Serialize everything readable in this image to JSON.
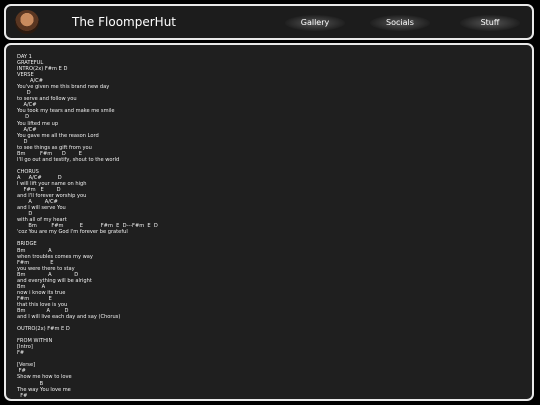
{
  "header": {
    "site_title": "The FloomperHut",
    "nav": [
      "Gallery",
      "Socials",
      "Stuff"
    ]
  },
  "content": {
    "lyrics": "DAY 1\nGRATEFUL\nINTRO(2x) F#m E D\nVERSE\n        A/C#\nYou've given me this brand new day\n      D\nto serve and follow you\n    A/C#\nYou took my tears and make me smile\n     D\nYou lifted me up\n    A/C#\nYou gave me all the reason Lord\n    D\nto see things as gift from you\nBm         F#m      D        E\nI'll go out and testify, shout to the world\n\nCHORUS\nA     A/C#          D\nI will lift your name on high\n    F#m   E        D\nand I'll forever worship you\n       A        A/C#\nand I will serve You\n       D\nwith all of my heart\n       Bm         F#m          E           F#m  E  D---F#m  E  D\n'coz You are my God I'm forever be grateful\n\nBRIDGE\nBm              A\nwhen troubles comes my way\nF#m             E\nyou were there to stay\nBm              A              D\nand everything will be alright\nBm          A\nnow i know its true\nF#m            E\nthat this love is you\nBm             A         D\nand I will live each day and say (Chorus)\n\nOUTRO(2x) F#m E D\n\nFROM WITHIN\n[Intro]\nF#\n\n[Verse]\n F#\nShow me how to love\n              B\nThe way You love me\n  F#\nTeach me to wait and hope\n        B"
  }
}
